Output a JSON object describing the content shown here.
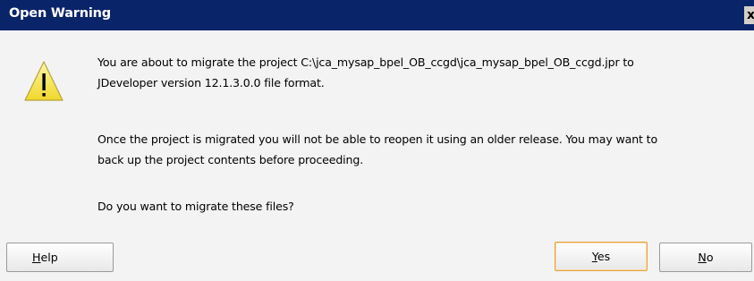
{
  "window": {
    "title": "Open Warning",
    "close_label": "x"
  },
  "icon": "warning-triangle-icon",
  "message": {
    "line1": "You are about to migrate the project C:\\jca_mysap_bpel_OB_ccgd\\jca_mysap_bpel_OB_ccgd.jpr to",
    "line2": "JDeveloper version 12.1.3.0.0 file format.",
    "line3": "Once the project is migrated you will not be able to reopen it using an older release. You may want to",
    "line4": "back up the project contents before proceeding.",
    "question": "Do you want to migrate these files?"
  },
  "buttons": {
    "help": {
      "mnemonic": "H",
      "rest": "elp"
    },
    "yes": {
      "mnemonic": "Y",
      "rest": "es"
    },
    "no": {
      "mnemonic": "N",
      "rest": "o"
    }
  },
  "colors": {
    "titlebar": "#0a246a",
    "dialog_bg": "#f3f3f3",
    "warning_yellow": "#f8e84a",
    "default_button_border": "#e8a440"
  }
}
